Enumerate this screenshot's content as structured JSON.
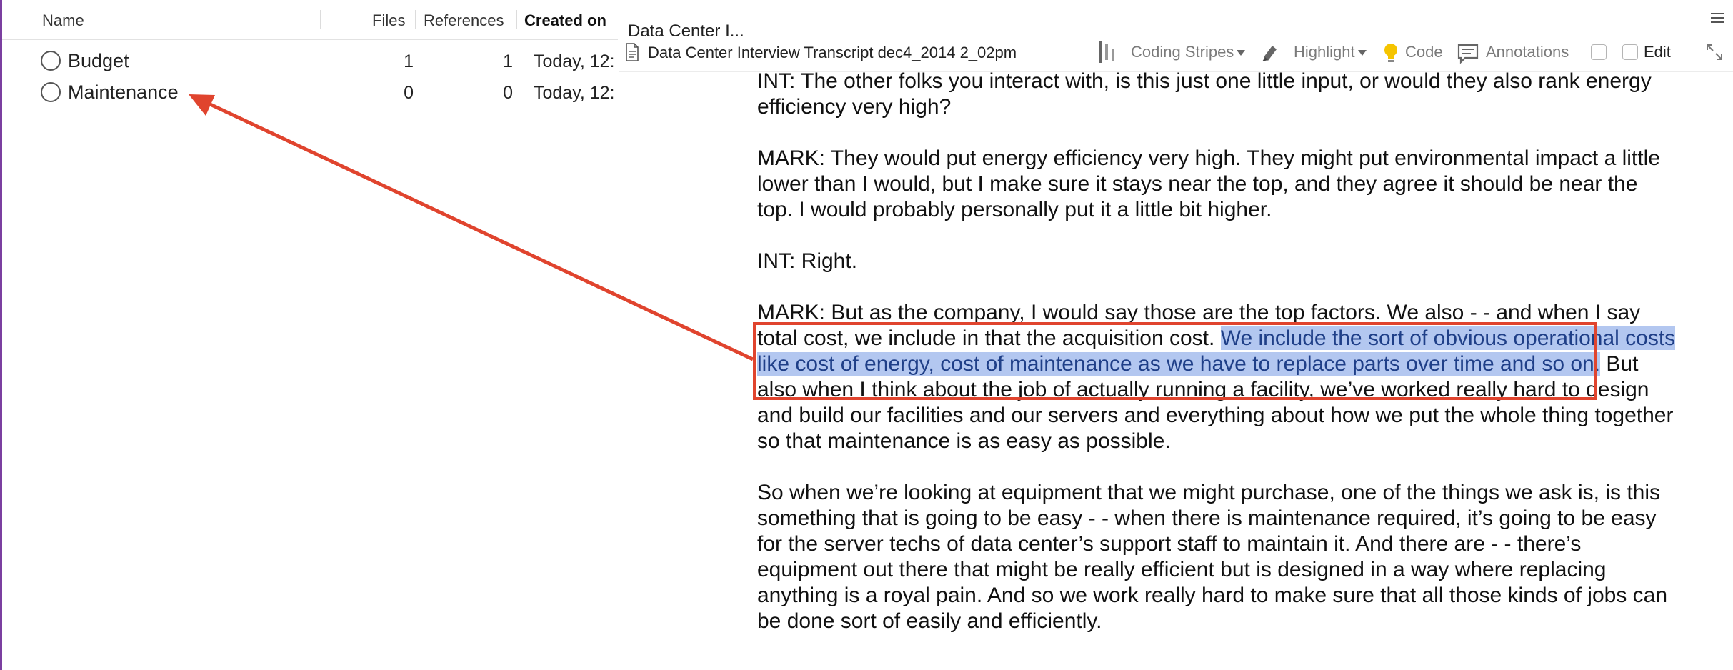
{
  "codes": {
    "columns": {
      "name": "Name",
      "files": "Files",
      "references": "References",
      "created_on": "Created on"
    },
    "rows": [
      {
        "name": "Budget",
        "files": "1",
        "references": "1",
        "created_on": "Today, 12:"
      },
      {
        "name": "Maintenance",
        "files": "0",
        "references": "0",
        "created_on": "Today, 12:"
      }
    ]
  },
  "document": {
    "tab_title": "Data Center I...",
    "file_name": "Data Center Interview Transcript dec4_2014 2_02pm",
    "toolbar": {
      "coding_stripes": "Coding Stripes",
      "highlight": "Highlight",
      "code": "Code",
      "annotations": "Annotations",
      "edit": "Edit"
    },
    "paragraphs": {
      "p1": "INT:  The other folks you interact with, is this just one little input, or would they also rank energy efficiency very high?",
      "p2": "MARK:  They would put energy efficiency very high.  They might put environmental impact a little lower than I would, but I make sure it stays near the top, and they agree it should be near the top.  I would probably personally put it a little bit higher.",
      "p3": "INT:  Right.",
      "p4_before": "MARK:  But as the company, I would say those are the top factors.  We also - - and when I say total cost, we include in that the acquisition cost.  ",
      "p4_highlight": "We include the sort of obvious operational costs like cost of energy, cost of maintenance as we have to replace parts over time and so on.",
      "p4_after": "  But also when I think about the job of actually running a facility, we’ve worked really hard to design and build our facilities and our servers and everything about how we put the whole thing together so that maintenance is as easy as possible.",
      "p5": "So when we’re looking at equipment that we might purchase, one of the things we ask is, is this something that is going to be easy - - when there is maintenance required, it’s going to be easy for the server techs of data center’s support staff to maintain it.  And there are - - there’s equipment out there that might be really efficient but is designed in a way where replacing anything is a royal pain.  And so we work really hard to make sure that all those kinds of jobs can be done sort of easily and efficiently."
    }
  },
  "colors": {
    "accent_purple": "#7b3fa0",
    "annotation_red": "#e0442e",
    "selection_blue": "#b3c7f0"
  },
  "icons": [
    "code-circle-icon",
    "document-icon",
    "coding-stripes-icon",
    "highlighter-icon",
    "lightbulb-icon",
    "annotation-icon",
    "expand-icon",
    "menu-icon",
    "arrow-annotation"
  ]
}
